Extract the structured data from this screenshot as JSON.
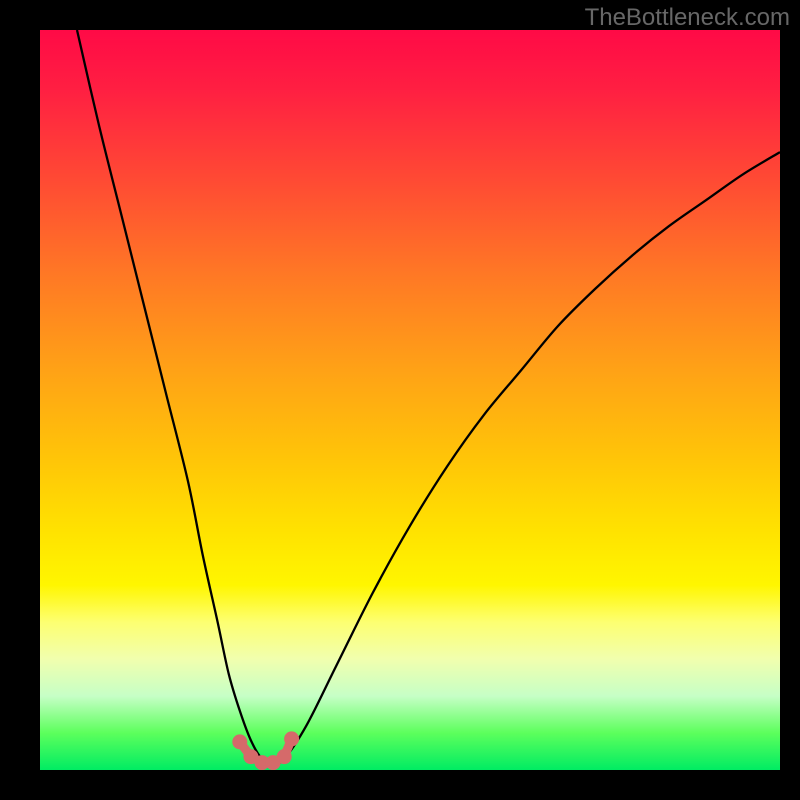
{
  "watermark": "TheBottleneck.com",
  "chart_data": {
    "type": "line",
    "title": "",
    "xlabel": "",
    "ylabel": "",
    "xlim": [
      0,
      100
    ],
    "ylim": [
      0,
      100
    ],
    "grid": false,
    "series": [
      {
        "name": "bottleneck-curve",
        "x": [
          5,
          8,
          11,
          14,
          17,
          20,
          22,
          24,
          25.5,
          27,
          28.5,
          30,
          31.5,
          33,
          36,
          40,
          45,
          50,
          55,
          60,
          65,
          70,
          75,
          80,
          85,
          90,
          95,
          100
        ],
        "y": [
          100,
          87,
          75,
          63,
          51,
          39,
          29,
          20,
          13,
          8,
          4,
          1.5,
          0.8,
          1.5,
          6,
          14,
          24,
          33,
          41,
          48,
          54,
          60,
          65,
          69.5,
          73.5,
          77,
          80.5,
          83.5
        ]
      }
    ],
    "markers": {
      "name": "optimal-zone",
      "color": "#d56a6a",
      "x": [
        27,
        28.5,
        30,
        31.5,
        33,
        34
      ],
      "y": [
        3.8,
        1.8,
        1,
        1,
        1.8,
        4.2
      ]
    },
    "gradient_stops": [
      {
        "pos": 0,
        "color": "#ff0a46"
      },
      {
        "pos": 20,
        "color": "#ff4934"
      },
      {
        "pos": 46,
        "color": "#ffa216"
      },
      {
        "pos": 68,
        "color": "#ffe300"
      },
      {
        "pos": 85,
        "color": "#f1ffae"
      },
      {
        "pos": 100,
        "color": "#00ec63"
      }
    ]
  }
}
